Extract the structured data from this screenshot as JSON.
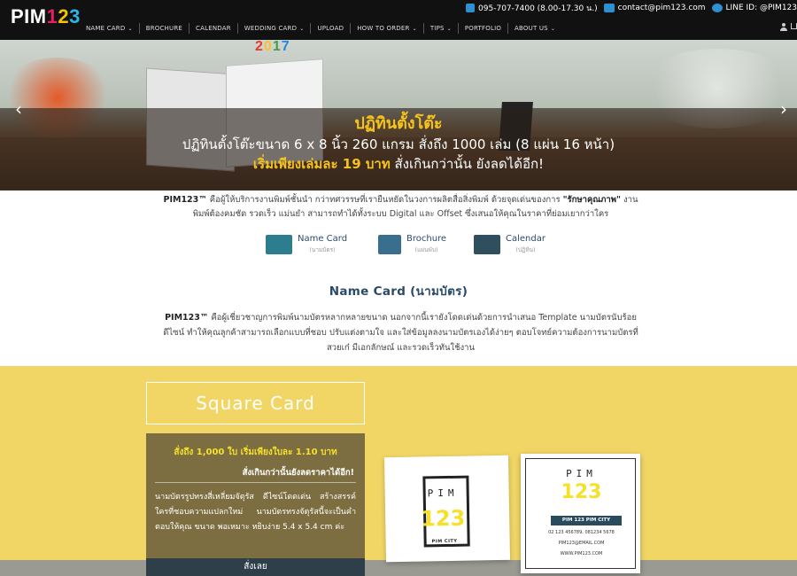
{
  "brand": {
    "logo": {
      "pim": "PIM",
      "d1": "1",
      "d2": "2",
      "d3": "3"
    },
    "colors": {
      "pink": "#e91e63",
      "yellow": "#f5c400",
      "blue": "#2bb5e8",
      "navy": "#2b4a6a"
    }
  },
  "contact": {
    "phone": "095-707-7400 (8.00-17.30 น.)",
    "email": "contact@pim123.com",
    "line": "LINE ID: @PIM123"
  },
  "nav": {
    "items": [
      {
        "label": "NAME CARD",
        "dropdown": true
      },
      {
        "label": "BROCHURE",
        "dropdown": false
      },
      {
        "label": "CALENDAR",
        "dropdown": false
      },
      {
        "label": "WEDDING CARD",
        "dropdown": true
      },
      {
        "label": "UPLOAD",
        "dropdown": false
      },
      {
        "label": "HOW TO ORDER",
        "dropdown": true
      },
      {
        "label": "TIPS",
        "dropdown": true
      },
      {
        "label": "PORTFOLIO",
        "dropdown": false
      },
      {
        "label": "ABOUT US",
        "dropdown": true
      }
    ],
    "chevron": "⌄"
  },
  "hero": {
    "calendar_year": [
      "2",
      "0",
      "1",
      "7"
    ],
    "title": "ปฏิทินตั้งโต๊ะ",
    "line2": "ปฏิทินตั้งโต๊ะขนาด 6 x 8 นิ้ว 260 แกรม สั่งถึง 1000 เล่ม (8 แผ่น 16 หน้า)",
    "line3_highlight": "เริ่มเพียงเล่มละ 19 บาท",
    "line3_rest": " สั่งเกินกว่านั้น ยังลดได้อีก!",
    "prev": "‹",
    "next": "›"
  },
  "intro": {
    "brand": "PIM123™",
    "text1": " คือผู้ให้บริการงานพิมพ์ชั้นนำ กว่าทศวรรษที่เรายืนหยัดในวงการผลิตสื่อสิ่งพิมพ์ ด้วยจุดเด่นของการ ",
    "quote": "\"รักษาคุณภาพ\"",
    "text2": " งานพิมพ์ต้องคมชัด รวดเร็ว แม่นยำ สามารถทำได้ทั้งระบบ Digital และ Offset ซึ่งเสนอให้คุณในราคาที่ย่อมเยากว่าใคร"
  },
  "products": [
    {
      "name": "Name Card",
      "sub": "(นามบัตร)",
      "icon": "name-card-icon"
    },
    {
      "name": "Brochure",
      "sub": "(แผ่นพับ)",
      "icon": "brochure-icon"
    },
    {
      "name": "Calendar",
      "sub": "(ปฏิทิน)",
      "icon": "calendar-icon"
    }
  ],
  "section": {
    "title": "Name Card (นามบัตร)",
    "brand": "PIM123™",
    "desc": " คือผู้เชี่ยวชาญการพิมพ์นามบัตรหลากหลายขนาด นอกจากนี้เรายังโดดเด่นด้วยการนำเสนอ Template นามบัตรนับร้อยดีไซน์ ทำให้คุณลูกค้าสามารถเลือกแบบที่ชอบ ปรับแต่งตามใจ และใส่ข้อมูลลงนามบัตรเองได้ง่ายๆ ตอบโจทย์ความต้องการนามบัตรที่สวยเก๋ มีเอกลักษณ์ และรวดเร็วทันใช้งาน"
  },
  "square_card": {
    "title": "Square Card",
    "promo": "สั่งถึง 1,000 ใบ เริ่มเพียงใบละ 1.10 บาท",
    "promo2": "สั่งเกินกว่านั้นยังลดราคาได้อีก!",
    "desc": "นามบัตรรูปทรงสี่เหลี่ยมจัตุรัส ดีไซน์โดดเด่น สร้างสรรค์ ใครที่ชอบความแปลกใหม่ นามบัตรทรงจัตุรัสนี้จะเป็นคำตอบให้คุณ ขนาด พอเหมาะ หยิบง่าย 5.4 x 5.4 cm ค่ะ",
    "button": "สั่งเลย"
  },
  "sample_cards": {
    "pim": "PIM",
    "num": "123",
    "city": "PIM CITY",
    "bar": "PIM 123 PIM CITY",
    "phone": "02 123 456789, 081234 5678",
    "email": "PIM123@EMAIL.COM",
    "web": "WWW.PIM123.COM"
  }
}
